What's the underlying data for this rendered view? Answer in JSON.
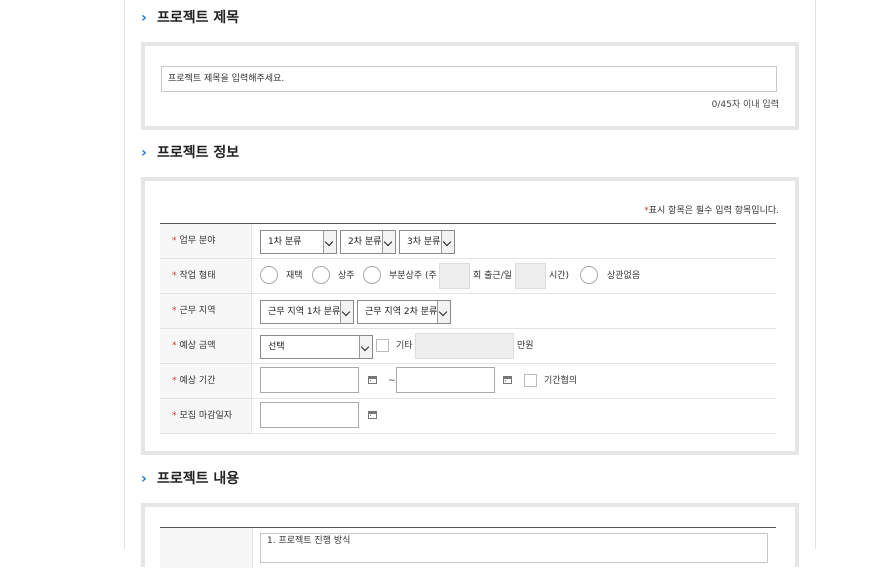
{
  "sections": {
    "title": {
      "heading": "프로젝트 제목",
      "input_placeholder": "프로젝트 제목을 입력해주세요.",
      "counter": "0/45자 이내 입력"
    },
    "info": {
      "heading": "프로젝트 정보",
      "required_star": "*",
      "required_note": "표시 항목은 필수 입력 항목입니다.",
      "rows": {
        "field": {
          "label": "업무 분야",
          "select1": "1차 분류",
          "select2": "2차 분류",
          "select3": "3차 분류"
        },
        "work_type": {
          "label": "작업 형태",
          "opt1": "재택",
          "opt2": "상주",
          "opt3": "부분상주 (주",
          "opt3_mid": "회 출근/일",
          "opt3_end": "시간)",
          "opt4": "상관없음"
        },
        "location": {
          "label": "근무 지역",
          "select1": "근무 지역 1차 분류",
          "select2": "근무 지역 2차 분류"
        },
        "budget": {
          "label": "예상 금액",
          "select": "선택",
          "other": "기타",
          "unit": "만원"
        },
        "period": {
          "label": "예상 기간",
          "tilde": "~",
          "negotiable": "기간협의"
        },
        "deadline": {
          "label": "모집 마감일자"
        }
      }
    },
    "content": {
      "heading": "프로젝트 내용",
      "first_line": "1. 프로젝트 진행 방식"
    }
  },
  "colors": {
    "accent": "#1f77c9",
    "required": "#d9302c",
    "border": "#e6e6e6"
  }
}
